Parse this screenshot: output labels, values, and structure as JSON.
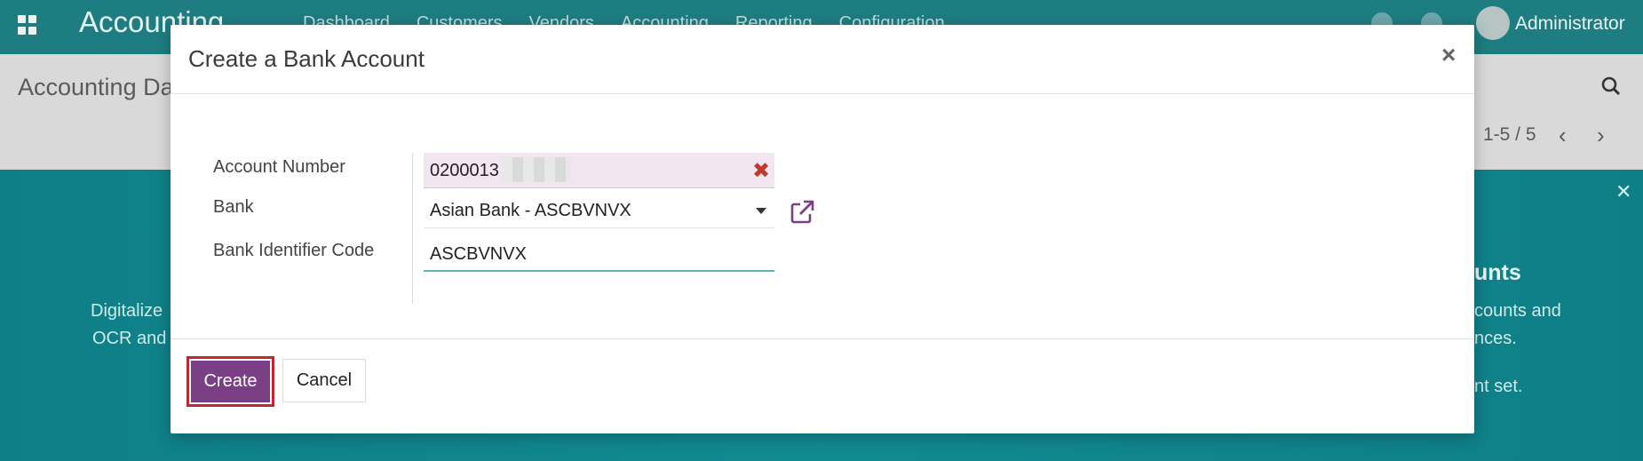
{
  "navbar": {
    "app_name": "Accounting",
    "menu": [
      "Dashboard",
      "Customers",
      "Vendors",
      "Accounting",
      "Reporting",
      "Configuration"
    ],
    "user": "Administrator"
  },
  "control_panel": {
    "title": "Accounting Dashboard",
    "pager": "1-5 / 5"
  },
  "dashboard": {
    "left_text_1": "Digitalize",
    "left_text_2": "OCR and",
    "right_heading": "unts",
    "right_text_1": "counts and",
    "right_text_2": "nces.",
    "right_text_3": "nt set."
  },
  "modal": {
    "title": "Create a Bank Account",
    "fields": {
      "account_number_label": "Account Number",
      "account_number_value": "0200013",
      "bank_label": "Bank",
      "bank_value": "Asian Bank - ASCBVNVX",
      "bic_label": "Bank Identifier Code",
      "bic_value": "ASCBVNVX"
    },
    "buttons": {
      "create": "Create",
      "cancel": "Cancel"
    }
  },
  "colors": {
    "navbar": "#1e7d80",
    "primary_button": "#7b3f86",
    "highlight_outline": "#c1272d"
  }
}
